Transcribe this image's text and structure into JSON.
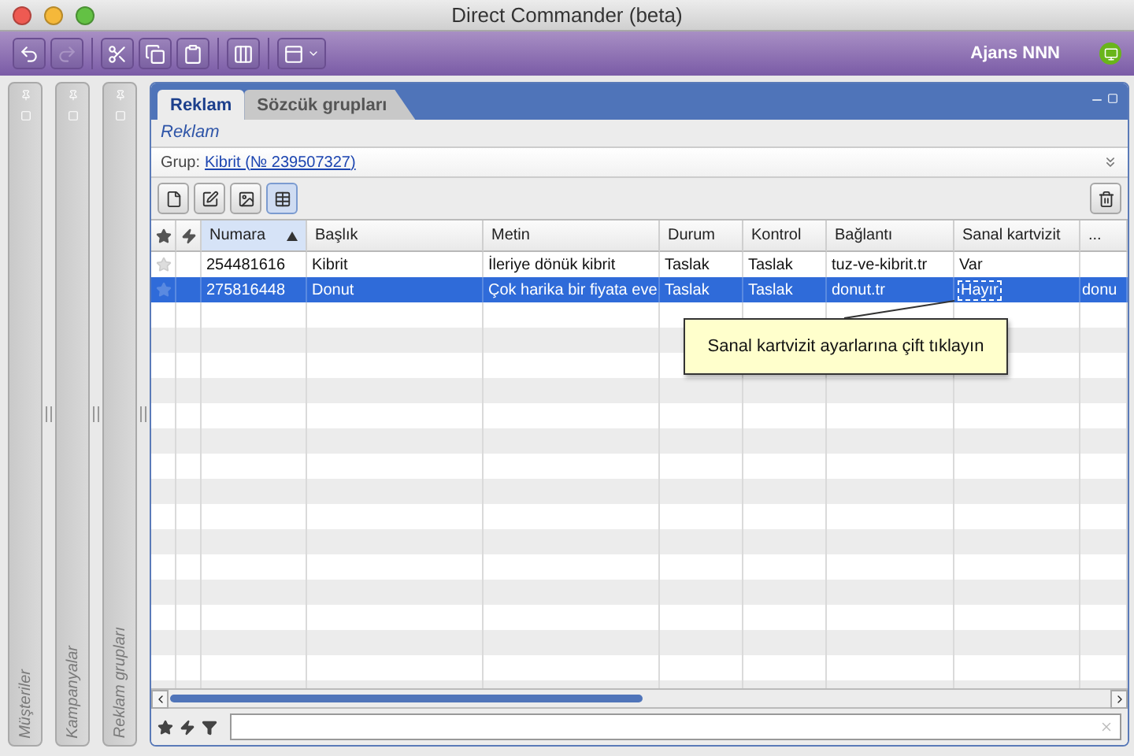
{
  "window": {
    "title": "Direct Commander (beta)"
  },
  "toolbar": {
    "buttons": [
      {
        "kind": "undo",
        "disabled": false
      },
      {
        "kind": "redo",
        "disabled": true
      },
      {
        "kind": "cut",
        "disabled": false
      },
      {
        "kind": "copy",
        "disabled": false
      },
      {
        "kind": "paste",
        "disabled": false
      },
      {
        "kind": "columns",
        "disabled": false
      },
      {
        "kind": "view",
        "disabled": false
      }
    ],
    "account": "Ajans NNN"
  },
  "side_panels": [
    {
      "label": "Müşteriler"
    },
    {
      "label": "Kampanyalar"
    },
    {
      "label": "Reklam grupları"
    }
  ],
  "tabs": [
    {
      "label": "Reklam",
      "selected": true
    },
    {
      "label": "Sözcük grupları",
      "selected": false
    }
  ],
  "subheader": "Reklam",
  "group": {
    "label": "Grup:",
    "link": "Kibrit (№ 239507327)"
  },
  "view_buttons": [
    {
      "kind": "new",
      "selected": false
    },
    {
      "kind": "edit",
      "selected": false
    },
    {
      "kind": "preview",
      "selected": false
    },
    {
      "kind": "table",
      "selected": true
    }
  ],
  "table": {
    "columns": [
      {
        "label": "Numara",
        "sorted": true
      },
      {
        "label": "Başlık",
        "sorted": false
      },
      {
        "label": "Metin",
        "sorted": false
      },
      {
        "label": "Durum",
        "sorted": false
      },
      {
        "label": "Kontrol",
        "sorted": false
      },
      {
        "label": "Bağlantı",
        "sorted": false
      },
      {
        "label": "Sanal kartvizit",
        "sorted": false
      },
      {
        "label": "...",
        "sorted": false
      }
    ],
    "rows": [
      {
        "selected": false,
        "cells": [
          {
            "text": "254481616",
            "focused": false
          },
          {
            "text": "Kibrit",
            "focused": false
          },
          {
            "text": "İleriye dönük kibrit",
            "focused": false
          },
          {
            "text": "Taslak",
            "focused": false
          },
          {
            "text": "Taslak",
            "focused": false
          },
          {
            "text": "tuz-ve-kibrit.tr",
            "focused": false
          },
          {
            "text": "Var",
            "focused": false
          }
        ]
      },
      {
        "selected": true,
        "cells": [
          {
            "text": "275816448",
            "focused": false
          },
          {
            "text": "Donut",
            "focused": false
          },
          {
            "text": "Çok harika bir fiyata eve",
            "focused": false
          },
          {
            "text": "Taslak",
            "focused": false
          },
          {
            "text": "Taslak",
            "focused": false
          },
          {
            "text": "donut.tr",
            "focused": false
          },
          {
            "text": "Hayır",
            "focused": true
          },
          {
            "text": "donu",
            "focused": false
          }
        ]
      }
    ]
  },
  "tooltip": "Sanal kartvizit ayarlarına çift tıklayın"
}
